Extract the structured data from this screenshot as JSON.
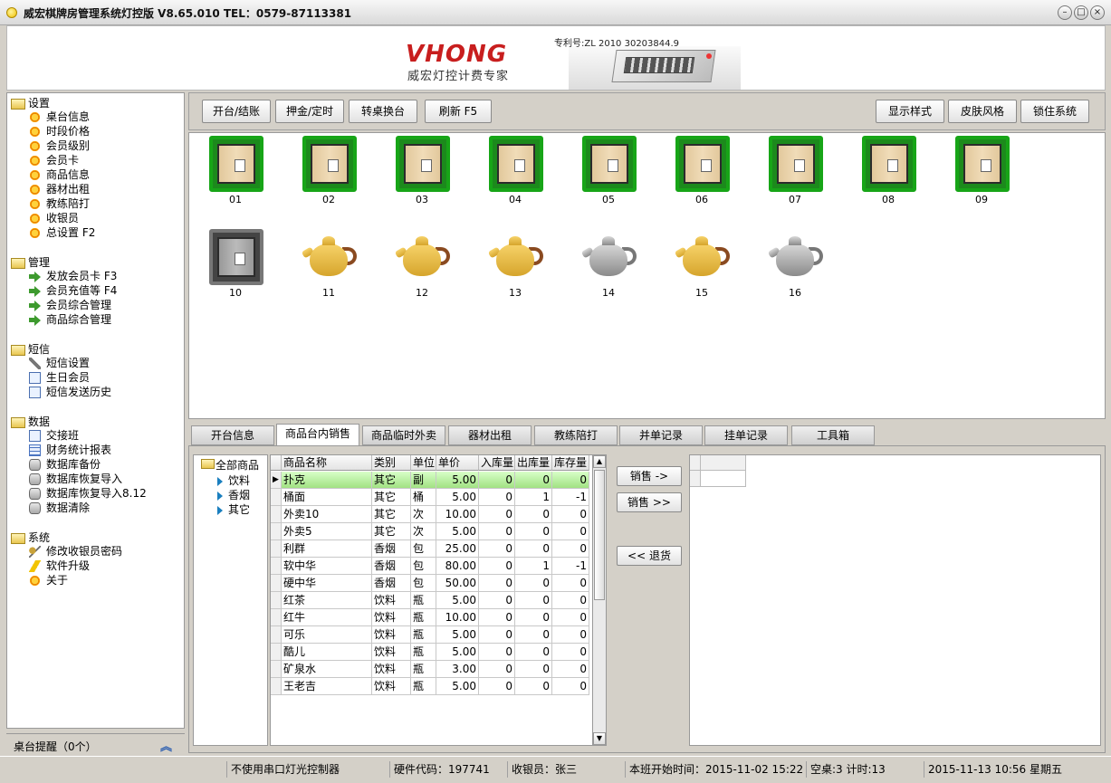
{
  "window": {
    "title": "威宏棋牌房管理系统灯控版 V8.65.010    TEL：0579-87113381"
  },
  "banner": {
    "logo": "VHONG",
    "slogan": "威宏灯控计费专家",
    "patent": "专利号:ZL 2010 30203844.9"
  },
  "sidebar": {
    "groups": [
      {
        "label": "设置",
        "items": [
          {
            "label": "桌台信息",
            "icon": "sun-icon"
          },
          {
            "label": "时段价格",
            "icon": "sun-icon"
          },
          {
            "label": "会员级别",
            "icon": "sun-icon"
          },
          {
            "label": "会员卡",
            "icon": "sun-icon"
          },
          {
            "label": "商品信息",
            "icon": "sun-icon"
          },
          {
            "label": "器材出租",
            "icon": "sun-icon"
          },
          {
            "label": "教练陪打",
            "icon": "sun-icon"
          },
          {
            "label": "收银员",
            "icon": "sun-icon"
          },
          {
            "label": "总设置 F2",
            "icon": "sun-icon"
          }
        ]
      },
      {
        "label": "管理",
        "items": [
          {
            "label": "发放会员卡 F3",
            "icon": "arrow-icon"
          },
          {
            "label": "会员充值等 F4",
            "icon": "arrow-icon"
          },
          {
            "label": "会员综合管理",
            "icon": "arrow-icon"
          },
          {
            "label": "商品综合管理",
            "icon": "arrow-icon"
          }
        ]
      },
      {
        "label": "短信",
        "items": [
          {
            "label": "短信设置",
            "icon": "tools-icon"
          },
          {
            "label": "生日会员",
            "icon": "document-icon"
          },
          {
            "label": "短信发送历史",
            "icon": "document-icon"
          }
        ]
      },
      {
        "label": "数据",
        "items": [
          {
            "label": "交接班",
            "icon": "document-icon"
          },
          {
            "label": "财务统计报表",
            "icon": "grid-icon"
          },
          {
            "label": "数据库备份",
            "icon": "database-icon"
          },
          {
            "label": "数据库恢复导入",
            "icon": "database-icon"
          },
          {
            "label": "数据库恢复导入8.12",
            "icon": "database-icon"
          },
          {
            "label": "数据清除",
            "icon": "database-icon"
          }
        ]
      },
      {
        "label": "系统",
        "items": [
          {
            "label": "修改收银员密码",
            "icon": "key-icon"
          },
          {
            "label": "软件升级",
            "icon": "bolt-icon"
          },
          {
            "label": "关于",
            "icon": "sun-icon"
          }
        ]
      }
    ],
    "footer": "桌台提醒（0个）"
  },
  "toolbar": {
    "open_close": "开台/结账",
    "deposit_timer": "押金/定时",
    "transfer": "转桌换台",
    "refresh": "刷新 F5",
    "display_style": "显示样式",
    "skin_style": "皮肤风格",
    "lock_system": "锁住系统"
  },
  "tables": [
    {
      "id": "01",
      "type": "mahjong-table-icon"
    },
    {
      "id": "02",
      "type": "mahjong-table-icon"
    },
    {
      "id": "03",
      "type": "mahjong-table-icon"
    },
    {
      "id": "04",
      "type": "mahjong-table-icon"
    },
    {
      "id": "05",
      "type": "mahjong-table-icon"
    },
    {
      "id": "06",
      "type": "mahjong-table-icon"
    },
    {
      "id": "07",
      "type": "mahjong-table-icon"
    },
    {
      "id": "08",
      "type": "mahjong-table-icon"
    },
    {
      "id": "09",
      "type": "mahjong-table-icon"
    },
    {
      "id": "10",
      "type": "mahjong-table-gray-icon"
    },
    {
      "id": "11",
      "type": "teapot-yellow-icon"
    },
    {
      "id": "12",
      "type": "teapot-yellow-icon"
    },
    {
      "id": "13",
      "type": "teapot-yellow-icon"
    },
    {
      "id": "14",
      "type": "teapot-gray-icon"
    },
    {
      "id": "15",
      "type": "teapot-yellow-icon"
    },
    {
      "id": "16",
      "type": "teapot-gray-icon"
    }
  ],
  "tabs": [
    "开台信息",
    "商品台内销售",
    "商品临时外卖",
    "器材出租",
    "教练陪打",
    "并单记录",
    "挂单记录",
    "工具箱"
  ],
  "active_tab": "商品台内销售",
  "categories": {
    "root": "全部商品",
    "children": [
      "饮料",
      "香烟",
      "其它"
    ]
  },
  "products": {
    "columns": [
      "商品名称",
      "类别",
      "单位",
      "单价",
      "入库量",
      "出库量",
      "库存量"
    ],
    "rows": [
      [
        "扑克",
        "其它",
        "副",
        "5.00",
        "0",
        "0",
        "0"
      ],
      [
        "桶面",
        "其它",
        "桶",
        "5.00",
        "0",
        "1",
        "-1"
      ],
      [
        "外卖10",
        "其它",
        "次",
        "10.00",
        "0",
        "0",
        "0"
      ],
      [
        "外卖5",
        "其它",
        "次",
        "5.00",
        "0",
        "0",
        "0"
      ],
      [
        "利群",
        "香烟",
        "包",
        "25.00",
        "0",
        "0",
        "0"
      ],
      [
        "软中华",
        "香烟",
        "包",
        "80.00",
        "0",
        "1",
        "-1"
      ],
      [
        "硬中华",
        "香烟",
        "包",
        "50.00",
        "0",
        "0",
        "0"
      ],
      [
        "红茶",
        "饮料",
        "瓶",
        "5.00",
        "0",
        "0",
        "0"
      ],
      [
        "红牛",
        "饮料",
        "瓶",
        "10.00",
        "0",
        "0",
        "0"
      ],
      [
        "可乐",
        "饮料",
        "瓶",
        "5.00",
        "0",
        "0",
        "0"
      ],
      [
        "酷儿",
        "饮料",
        "瓶",
        "5.00",
        "0",
        "0",
        "0"
      ],
      [
        "矿泉水",
        "饮料",
        "瓶",
        "3.00",
        "0",
        "0",
        "0"
      ],
      [
        "王老吉",
        "饮料",
        "瓶",
        "5.00",
        "0",
        "0",
        "0"
      ]
    ]
  },
  "actions": {
    "sell_one": "销售 ->",
    "sell_all": "销售 >>",
    "return": "<< 退货"
  },
  "status": {
    "serial": "不使用串口灯光控制器",
    "hardware": "硬件代码：197741",
    "cashier": "收银员：张三",
    "shift_start": "本班开始时间：2015-11-02 15:22",
    "vacant": "空桌:3 计时:13",
    "datetime": "2015-11-13 10:56 星期五"
  }
}
